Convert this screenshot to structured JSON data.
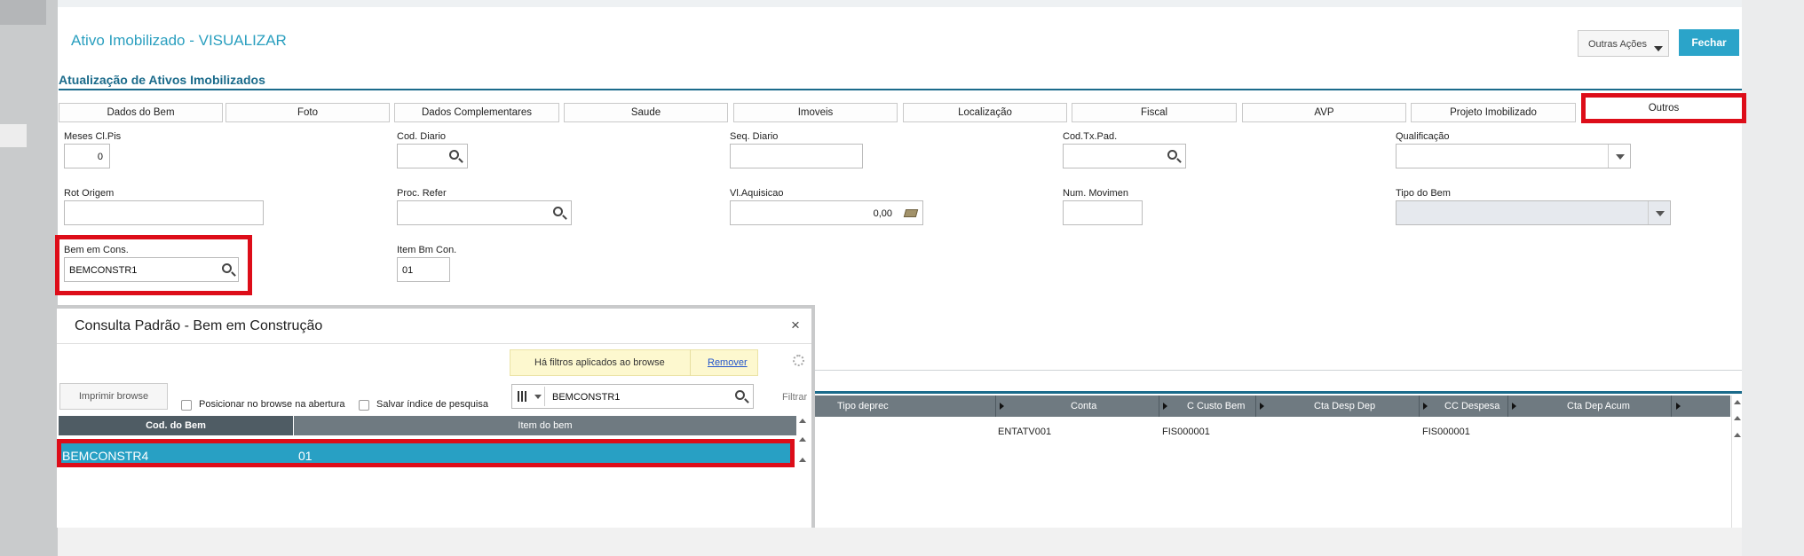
{
  "app": {
    "title": "Ativo Imobilizado - VISUALIZAR",
    "other_actions_label": "Outras Ações",
    "close_label": "Fechar"
  },
  "section_title": "Atualização de Ativos Imobilizados",
  "tabs": [
    "Dados do Bem",
    "Foto",
    "Dados Complementares",
    "Saude",
    "Imoveis",
    "Localização",
    "Fiscal",
    "AVP",
    "Projeto Imobilizado",
    "Outros"
  ],
  "active_tab": "Outros",
  "fields": {
    "meses_cl_pis": {
      "label": "Meses Cl.Pis",
      "value": "0"
    },
    "cod_diario": {
      "label": "Cod. Diario",
      "value": ""
    },
    "seq_diario": {
      "label": "Seq. Diario",
      "value": ""
    },
    "cod_tx_pad": {
      "label": "Cod.Tx.Pad.",
      "value": ""
    },
    "qualificacao": {
      "label": "Qualificação",
      "value": ""
    },
    "rot_origem": {
      "label": "Rot Origem",
      "value": ""
    },
    "proc_refer": {
      "label": "Proc. Refer",
      "value": ""
    },
    "vl_aquisicao": {
      "label": "Vl.Aquisicao",
      "value": "0,00"
    },
    "num_movimen": {
      "label": "Num. Movimen",
      "value": ""
    },
    "tipo_do_bem": {
      "label": "Tipo do Bem",
      "value": ""
    },
    "bem_em_cons": {
      "label": "Bem em Cons.",
      "value": "BEMCONSTR1"
    },
    "item_bm_con": {
      "label": "Item Bm Con.",
      "value": "01"
    }
  },
  "dialog": {
    "title": "Consulta Padrão - Bem em Construção",
    "close_symbol": "×",
    "filter_notice": "Há filtros aplicados ao browse",
    "remove_label": "Remover",
    "print_label": "Imprimir browse",
    "option_position": "Posicionar no browse na abertura",
    "option_save_index": "Salvar índice de pesquisa",
    "search_value": "BEMCONSTR1",
    "filter_label": "Filtrar",
    "columns": [
      "Cod. do Bem",
      "Item do bem"
    ],
    "rows": [
      {
        "cod": "BEMCONSTR4",
        "item": "01"
      }
    ]
  },
  "background_grid": {
    "columns": [
      "Tipo deprec",
      "Conta",
      "C Custo Bem",
      "Cta Desp Dep",
      "CC Despesa",
      "Cta Dep Acum"
    ],
    "row": [
      "ENTATV001",
      "FIS000001",
      "FIS000001"
    ]
  },
  "colors": {
    "accent": "#2ba4c9",
    "title": "#2a9fbf",
    "section": "#1b6b8b",
    "highlight": "#dd0d19",
    "selected_row": "#28a0c4",
    "filter_notice_bg": "#fdf8cf"
  }
}
